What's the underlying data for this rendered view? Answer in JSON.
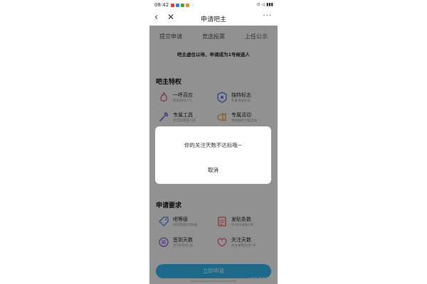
{
  "status_bar": {
    "time": "08:42",
    "right": "⊙ ◁ ▮▮▮"
  },
  "nav": {
    "back_icon": "chevron-left-icon",
    "close_icon": "close-icon",
    "title": "申请吧主",
    "more_icon": "ellipsis-icon"
  },
  "tabs": [
    {
      "label": "提交申请"
    },
    {
      "label": "竞选投票"
    },
    {
      "label": "上任公示"
    }
  ],
  "banner": "吧主虚位以待，申请成为1号候选人",
  "privileges": {
    "title": "吧主特权",
    "items": [
      {
        "label": "一呼百应",
        "sub": "获取发吧人气",
        "icon": "flame-icon",
        "color": "#e95a8a"
      },
      {
        "label": "独特标志",
        "sub": "专属身份标志",
        "icon": "badge-icon",
        "color": "#5b6fe6"
      },
      {
        "label": "专属工具",
        "sub": "齐全的管理工具",
        "icon": "wrench-icon",
        "color": "#8a5be0"
      },
      {
        "label": "专属活动",
        "sub": "承办贴吧大型活动",
        "icon": "megaphone-icon",
        "color": "#e9a43c"
      }
    ]
  },
  "requirements": {
    "title": "申请要求",
    "items": [
      {
        "label": "吧等级",
        "sub": "吧内等级达到6级",
        "icon": "tag-icon",
        "color": "#4d89e8"
      },
      {
        "label": "发贴条数",
        "sub": "近30天发贴1条",
        "icon": "document-icon",
        "color": "#e95a5a"
      },
      {
        "label": "签到天数",
        "sub": "近7天签到3天",
        "icon": "list-icon",
        "color": "#8a5be0"
      },
      {
        "label": "关注天数",
        "sub": "关注本吧达到7天",
        "icon": "heart-icon",
        "color": "#e95a8a"
      }
    ]
  },
  "apply_button": "立即申请",
  "watermark": "@知乎 吉林天池吧",
  "dialog": {
    "message": "你的关注天数不达标哦~",
    "cancel": "取消"
  },
  "colors": {
    "accent": "#31b6ee",
    "overlay": "rgba(0,0,0,0.42)"
  }
}
